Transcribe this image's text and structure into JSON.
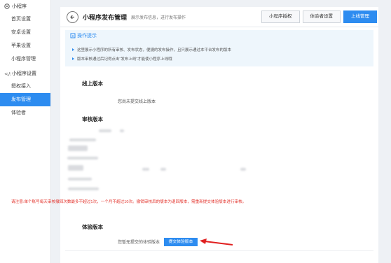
{
  "sidebar": {
    "group_mini": "小程序",
    "items": [
      "首页设置",
      "安卓设置",
      "苹果设置",
      "小程序管理"
    ],
    "group_settings": "小程序设置",
    "items2": [
      "授权接入",
      "发布管理",
      "体验者"
    ]
  },
  "header": {
    "title": "小程序发布管理",
    "subtitle": "展示发布信息，进行发布操作"
  },
  "tabs": [
    "小程序授权",
    "体验者设置",
    "上线管理"
  ],
  "tips": {
    "title": "操作提示",
    "lines": [
      "这里展示小程序的所有审核、发布状态，便捷的发布操作，且只展示通过本平台发布的版本",
      "版本审核通过后记得点击“发布上线”才能使小程序上线哦"
    ]
  },
  "online": {
    "title": "线上版本",
    "empty": "您尚未提交线上版本"
  },
  "review": {
    "title": "审核版本",
    "warning": "请注意:单个账号每天审核撤回次数最多不超过1次，一个月不超过10次。撤销审核后的版本为退回版本，需重新提交体验版本进行审核。"
  },
  "trial": {
    "title": "体验版本",
    "empty": "您暂无提交的体验版本",
    "submit_label": "提交体验版本"
  },
  "colors": {
    "accent": "#2d8cf0",
    "warning": "#e3322b",
    "arrow": "#e02020"
  }
}
